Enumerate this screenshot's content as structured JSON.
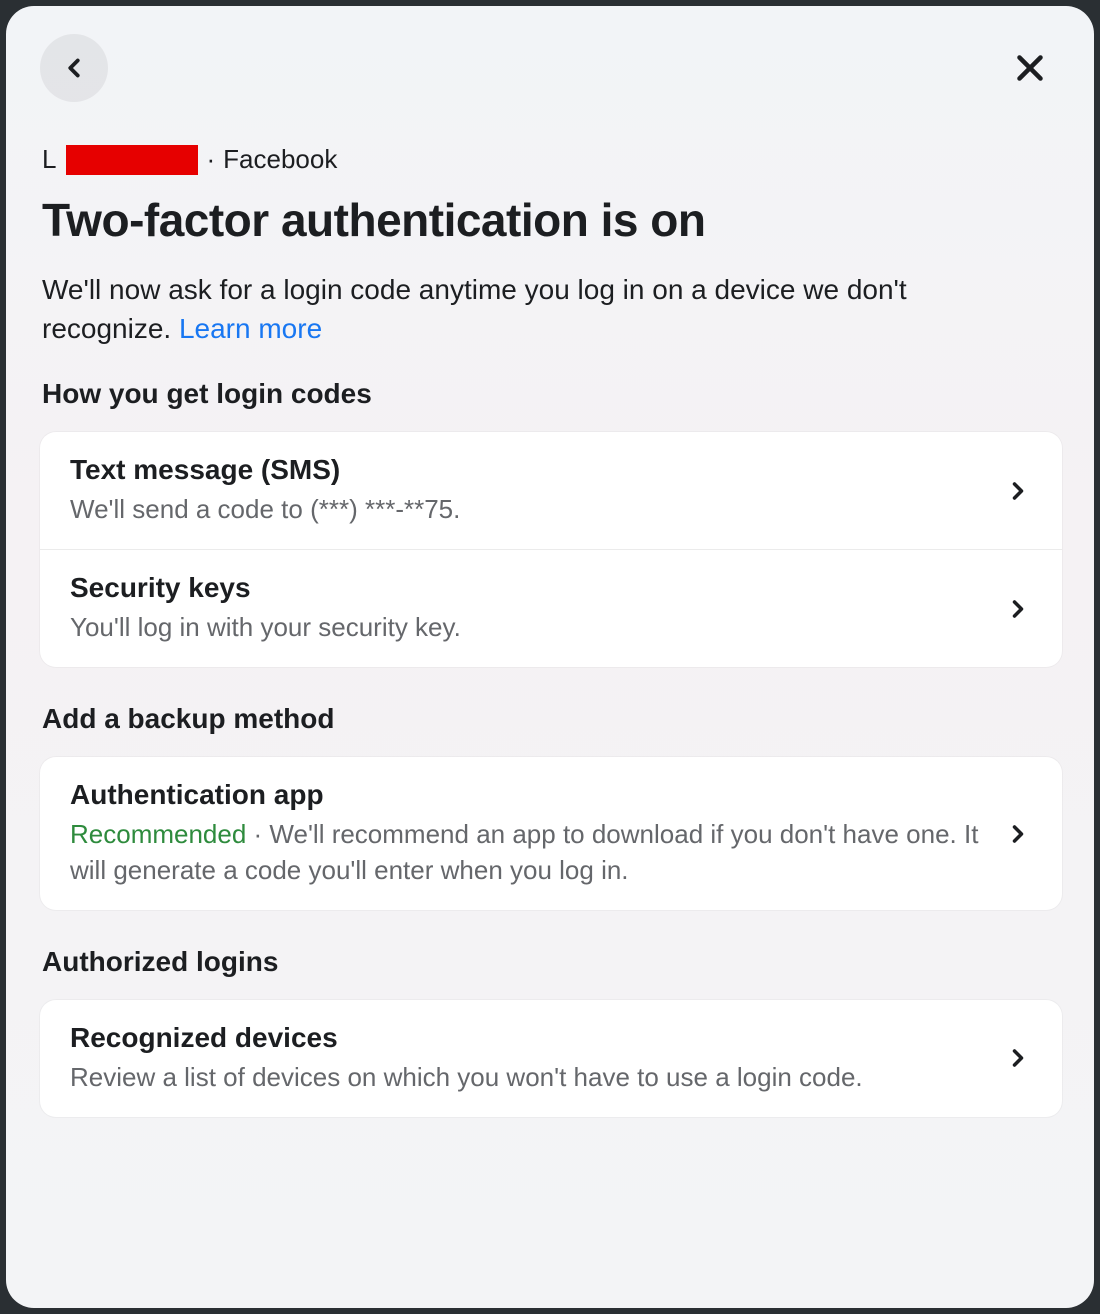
{
  "breadcrumb": {
    "first_letter": "L",
    "platform": "Facebook"
  },
  "title": "Two-factor authentication is on",
  "description_pre": "We'll now ask for a login code anytime you log in on a device we don't recognize. ",
  "learn_more": "Learn more",
  "sections": {
    "login_codes_heading": "How you get login codes",
    "backup_heading": "Add a backup method",
    "authorized_heading": "Authorized logins"
  },
  "methods": {
    "sms": {
      "title": "Text message (SMS)",
      "sub": "We'll send a code to (***) ***-**75."
    },
    "security_keys": {
      "title": "Security keys",
      "sub": "You'll log in with your security key."
    },
    "auth_app": {
      "title": "Authentication app",
      "recommended_label": "Recommended",
      "sub_sep": " · ",
      "sub_rest": "We'll recommend an app to download if you don't have one. It will generate a code you'll enter when you log in."
    },
    "recognized": {
      "title": "Recognized devices",
      "sub": "Review a list of devices on which you won't have to use a login code."
    }
  }
}
